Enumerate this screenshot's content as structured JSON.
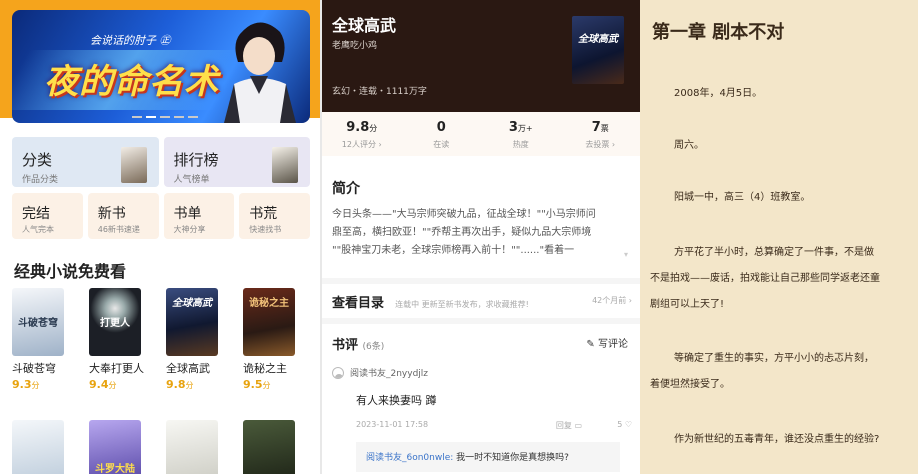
{
  "home": {
    "banner": {
      "subtitle": "会说话的肘子 ㊣",
      "title": "夜的命名术"
    },
    "categories": [
      {
        "label": "分类",
        "sub": "作品分类",
        "color": "#dfe8f3"
      },
      {
        "label": "排行榜",
        "sub": "人气榜单",
        "color": "#e8e6f3"
      }
    ],
    "mini": [
      {
        "label": "完结",
        "sub": "人气完本"
      },
      {
        "label": "新书",
        "sub": "46新书速递"
      },
      {
        "label": "书单",
        "sub": "大神分享"
      },
      {
        "label": "书荒",
        "sub": "快速找书"
      }
    ],
    "section_title": "经典小说免费看",
    "books": [
      {
        "name": "斗破苍穹",
        "score": "9.3",
        "unit": "分",
        "cover_text": "斗破苍穹",
        "color": "#e9eef5"
      },
      {
        "name": "大奉打更人",
        "score": "9.4",
        "unit": "分",
        "cover_text": "打更人",
        "color": "#1c1f26"
      },
      {
        "name": "全球高武",
        "score": "9.8",
        "unit": "分",
        "cover_text": "全球高武",
        "color": "#28304d"
      },
      {
        "name": "诡秘之主",
        "score": "9.5",
        "unit": "分",
        "cover_text": "诡秘之主",
        "color": "#3d2a22"
      },
      {
        "name": "",
        "score": "",
        "unit": "",
        "cover_text": "",
        "color": "#e6eef6"
      },
      {
        "name": "",
        "score": "",
        "unit": "",
        "cover_text": "斗罗大陆",
        "color": "#6a5ac0"
      },
      {
        "name": "",
        "score": "",
        "unit": "",
        "cover_text": "",
        "color": "#e9e9e6"
      },
      {
        "name": "",
        "score": "",
        "unit": "",
        "cover_text": "",
        "color": "#2a2f24"
      }
    ]
  },
  "detail": {
    "title": "全球高武",
    "author": "老鹰吃小鸡",
    "meta": "玄幻・连载・1111万字",
    "cover_text": "全球高武",
    "stats": [
      {
        "value": "9.8",
        "unit": "分",
        "label": "12人评分 ›"
      },
      {
        "value": "0",
        "unit": "",
        "label": "在读"
      },
      {
        "value": "3",
        "unit": "万+",
        "label": "热度"
      },
      {
        "value": "7",
        "unit": "票",
        "label": "去投票 ›"
      }
    ],
    "intro_heading": "简介",
    "intro_lines": [
      "今日头条——\"大马宗师突破九品，征战全球！\"\"小马宗师问",
      "鼎至高，横扫欧亚！\"\"乔帮主再次出手，疑似九品大宗师境",
      "\"\"股神宝刀未老，全球宗师榜再入前十！\"\"......\"看着一"
    ],
    "toc_heading": "查看目录",
    "toc_desc": "连载中 更新至新书发布，求收藏推荐!",
    "toc_time": "42个月前 ›",
    "review_heading": "书评",
    "review_count": "(6条)",
    "write_review": "写评论",
    "review_user": "阅读书友_2nyydjlz",
    "review_text": "有人来换妻吗 蹲",
    "review_date": "2023-11-01 17:58",
    "reply_label": "回复",
    "like_count": "5",
    "sub_user": "阅读书友_6on0nwle:",
    "sub_text": " 我一时不知道你是真想换吗?"
  },
  "reader": {
    "chapter_title": "第一章 剧本不对",
    "paragraphs": [
      "2008年，4月5日。",
      "周六。",
      "阳城一中，高三（4）班教室。",
      "方平花了半小时，总算确定了一件事，不是做",
      "不是拍戏——废话，拍戏能让自己那些同学返老还童",
      "剧组可以上天了!",
      "等确定了重生的事实，方平小小的忐忑片刻，",
      "着便坦然接受了。",
      "作为新世纪的五毒青年，谁还没点重生的经验?"
    ]
  },
  "colors": {
    "accent_orange": "#f5a41c",
    "score_gold": "#e8a30e",
    "reader_bg": "#f3e6c9"
  }
}
